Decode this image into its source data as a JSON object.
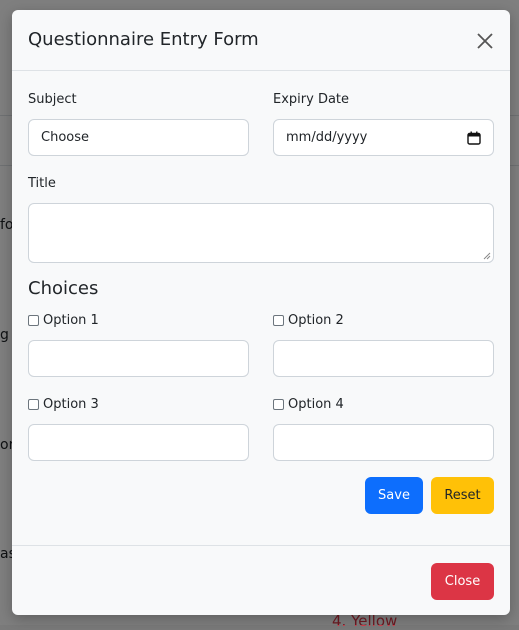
{
  "background": {
    "fragments": [
      "fo",
      "g",
      "or",
      "as"
    ],
    "visible_text": "4. Yellow"
  },
  "modal": {
    "title": "Questionnaire Entry Form",
    "subject": {
      "label": "Subject",
      "value": "Choose"
    },
    "expiry": {
      "label": "Expiry Date",
      "placeholder": "mm/dd/yyyy"
    },
    "title_field": {
      "label": "Title",
      "value": ""
    },
    "choices": {
      "heading": "Choices",
      "options": [
        {
          "label": "Option 1",
          "checked": false,
          "value": ""
        },
        {
          "label": "Option 2",
          "checked": false,
          "value": ""
        },
        {
          "label": "Option 3",
          "checked": false,
          "value": ""
        },
        {
          "label": "Option 4",
          "checked": false,
          "value": ""
        }
      ]
    },
    "buttons": {
      "save": "Save",
      "reset": "Reset",
      "close": "Close"
    }
  },
  "colors": {
    "primary": "#0d6efd",
    "warning": "#ffc107",
    "danger": "#dc3545",
    "modal_bg": "#f8f9fa"
  }
}
